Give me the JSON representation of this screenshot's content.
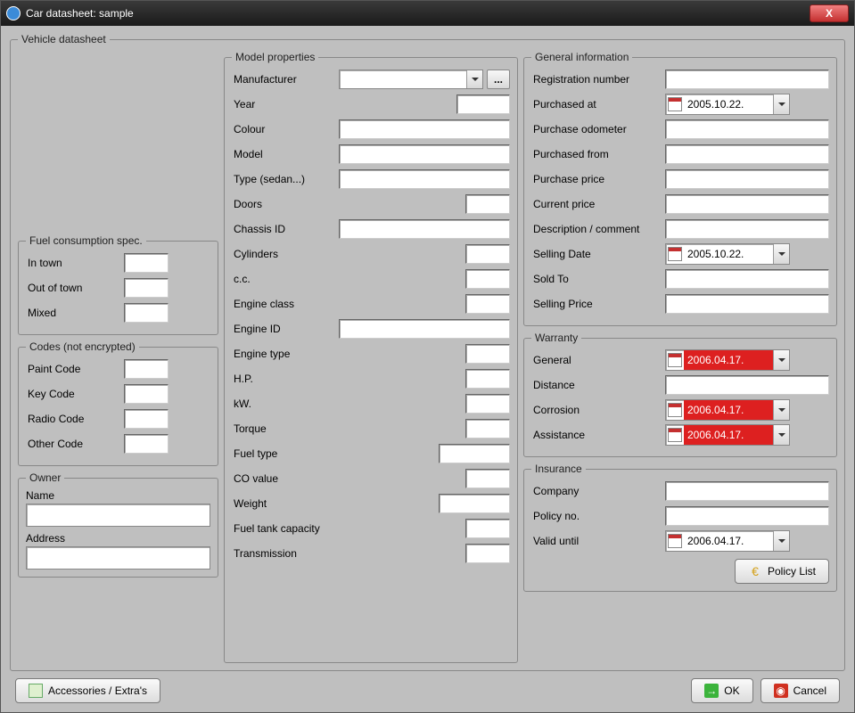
{
  "window": {
    "title": "Car datasheet: sample"
  },
  "vehicleDatasheet": {
    "legend": "Vehicle datasheet"
  },
  "fuelSpec": {
    "legend": "Fuel consumption spec.",
    "inTown": {
      "label": "In town",
      "value": ""
    },
    "outOfTown": {
      "label": "Out of town",
      "value": ""
    },
    "mixed": {
      "label": "Mixed",
      "value": ""
    }
  },
  "codes": {
    "legend": "Codes (not encrypted)",
    "paint": {
      "label": "Paint Code",
      "value": ""
    },
    "key": {
      "label": "Key Code",
      "value": ""
    },
    "radio": {
      "label": "Radio Code",
      "value": ""
    },
    "other": {
      "label": "Other Code",
      "value": ""
    }
  },
  "owner": {
    "legend": "Owner",
    "name": {
      "label": "Name",
      "value": ""
    },
    "address": {
      "label": "Address",
      "value": ""
    }
  },
  "model": {
    "legend": "Model properties",
    "manufacturer": {
      "label": "Manufacturer",
      "value": ""
    },
    "year": {
      "label": " Year",
      "value": ""
    },
    "colour": {
      "label": " Colour",
      "value": ""
    },
    "modelName": {
      "label": "Model",
      "value": ""
    },
    "type": {
      "label": "Type (sedan...)",
      "value": ""
    },
    "doors": {
      "label": "Doors",
      "value": ""
    },
    "chassis": {
      "label": "Chassis ID",
      "value": ""
    },
    "cylinders": {
      "label": "Cylinders",
      "value": ""
    },
    "cc": {
      "label": "c.c.",
      "value": ""
    },
    "engineClass": {
      "label": "Engine class",
      "value": ""
    },
    "engineId": {
      "label": "Engine ID",
      "value": ""
    },
    "engineType": {
      "label": "Engine type",
      "value": ""
    },
    "hp": {
      "label": "H.P.",
      "value": ""
    },
    "kw": {
      "label": "kW.",
      "value": ""
    },
    "torque": {
      "label": "Torque",
      "value": ""
    },
    "fuelType": {
      "label": "Fuel type",
      "value": ""
    },
    "co": {
      "label": "CO value",
      "value": ""
    },
    "weight": {
      "label": "Weight",
      "value": ""
    },
    "tank": {
      "label": "Fuel tank capacity",
      "value": ""
    },
    "transmission": {
      "label": "Transmission",
      "value": ""
    }
  },
  "general": {
    "legend": "General information",
    "reg": {
      "label": "Registration number",
      "value": ""
    },
    "purchasedAt": {
      "label": "Purchased at",
      "value": "2005.10.22."
    },
    "purchaseOdo": {
      "label": "Purchase odometer",
      "value": ""
    },
    "purchasedFrom": {
      "label": "Purchased from",
      "value": ""
    },
    "purchasePrice": {
      "label": "Purchase price",
      "value": ""
    },
    "currentPrice": {
      "label": "Current price",
      "value": ""
    },
    "desc": {
      "label": "Description / comment",
      "value": ""
    },
    "sellingDate": {
      "label": "Selling Date",
      "value": "2005.10.22."
    },
    "soldTo": {
      "label": "Sold To",
      "value": ""
    },
    "sellingPrice": {
      "label": "Selling Price",
      "value": ""
    }
  },
  "warranty": {
    "legend": "Warranty",
    "general": {
      "label": "General",
      "value": "2006.04.17."
    },
    "distance": {
      "label": "Distance",
      "value": ""
    },
    "corrosion": {
      "label": "Corrosion",
      "value": "2006.04.17."
    },
    "assistance": {
      "label": "Assistance",
      "value": "2006.04.17."
    }
  },
  "insurance": {
    "legend": "Insurance",
    "company": {
      "label": "Company",
      "value": ""
    },
    "policyNo": {
      "label": "Policy no.",
      "value": ""
    },
    "validUntil": {
      "label": "Valid until",
      "value": "2006.04.17."
    },
    "policyListBtn": "Policy List"
  },
  "buttons": {
    "accessories": "Accessories / Extra's",
    "ok": "OK",
    "cancel": "Cancel",
    "ellipsis": "..."
  }
}
